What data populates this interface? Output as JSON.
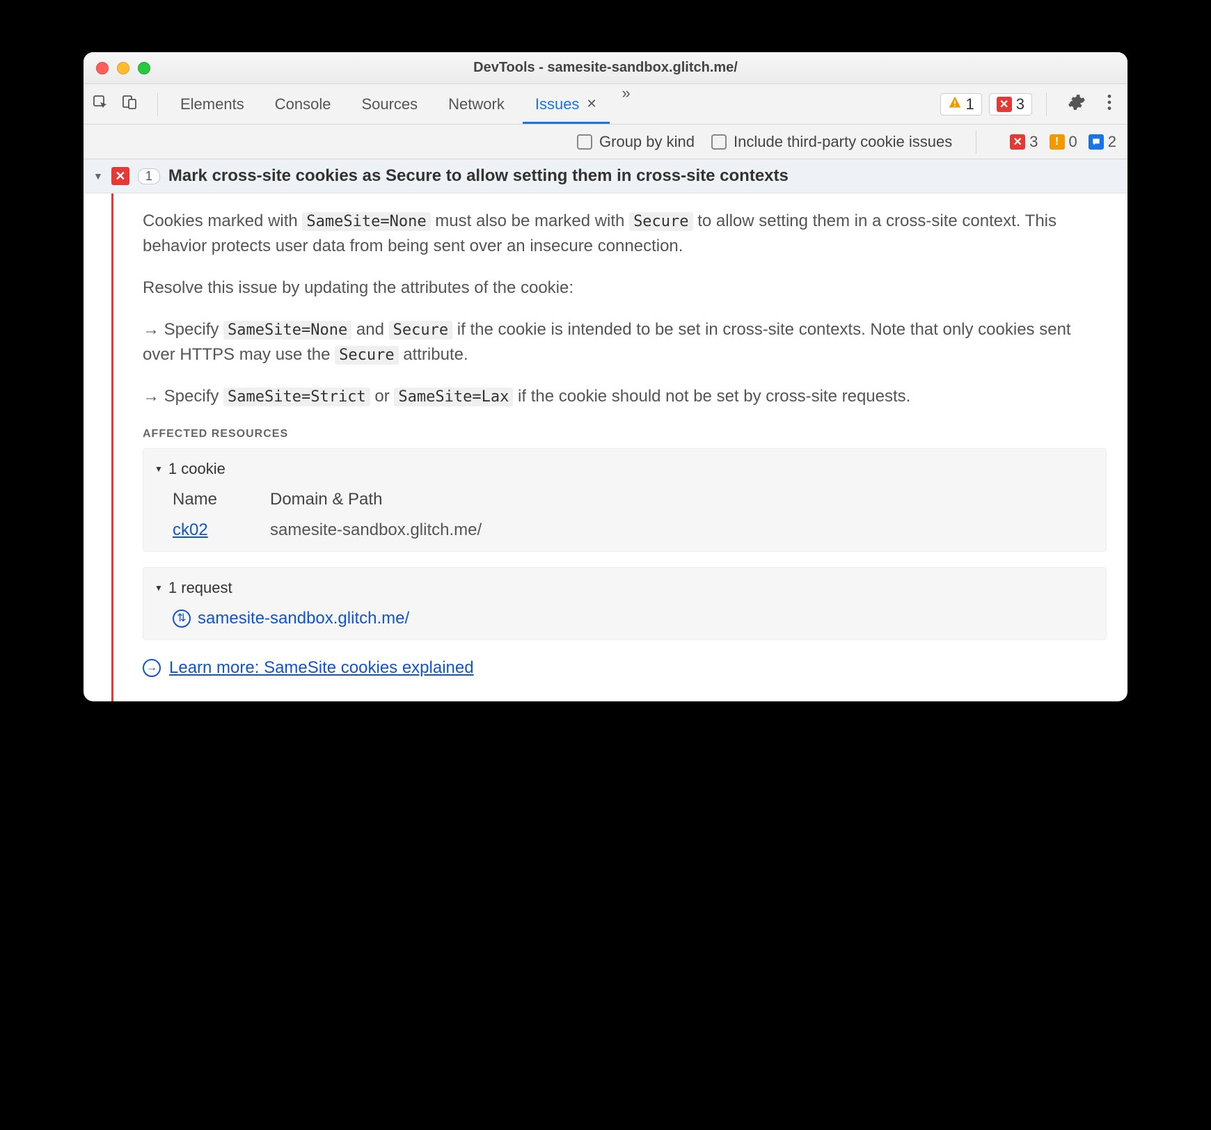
{
  "window": {
    "title": "DevTools - samesite-sandbox.glitch.me/"
  },
  "tabs": {
    "items": [
      "Elements",
      "Console",
      "Sources",
      "Network",
      "Issues"
    ],
    "activeIndex": 4
  },
  "topbar": {
    "warnings": "1",
    "errors": "3"
  },
  "filter": {
    "group_label": "Group by kind",
    "thirdparty_label": "Include third-party cookie issues",
    "counts": {
      "error": "3",
      "warn": "0",
      "info": "2"
    }
  },
  "issue": {
    "count": "1",
    "title": "Mark cross-site cookies as Secure to allow setting them in cross-site contexts",
    "para1_a": "Cookies marked with ",
    "code1": "SameSite=None",
    "para1_b": " must also be marked with ",
    "code2": "Secure",
    "para1_c": " to allow setting them in a cross-site context. This behavior protects user data from being sent over an insecure connection.",
    "para2": "Resolve this issue by updating the attributes of the cookie:",
    "bullet1_a": "Specify ",
    "bullet1_code1": "SameSite=None",
    "bullet1_b": " and ",
    "bullet1_code2": "Secure",
    "bullet1_c": " if the cookie is intended to be set in cross-site contexts. Note that only cookies sent over HTTPS may use the ",
    "bullet1_code3": "Secure",
    "bullet1_d": " attribute.",
    "bullet2_a": "Specify ",
    "bullet2_code1": "SameSite=Strict",
    "bullet2_b": " or ",
    "bullet2_code2": "SameSite=Lax",
    "bullet2_c": " if the cookie should not be set by cross-site requests.",
    "affected_label": "AFFECTED RESOURCES",
    "cookie_box_title": "1 cookie",
    "cookie_table": {
      "h1": "Name",
      "h2": "Domain & Path",
      "name": "ck02",
      "domain": "samesite-sandbox.glitch.me/"
    },
    "request_box_title": "1 request",
    "request_url": "samesite-sandbox.glitch.me/",
    "learn_more": "Learn more: SameSite cookies explained"
  }
}
